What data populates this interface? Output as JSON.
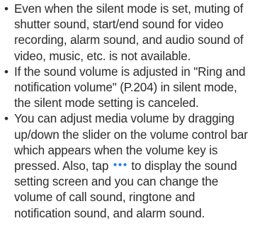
{
  "accent_color": "#2e7fd6",
  "icons": {
    "more_dots": "three-dots-icon"
  },
  "bullets": [
    {
      "lines": [
        "Even when the silent mode is set, muting of",
        "shutter sound, start/end sound for video",
        "recording, alarm sound, and audio sound of",
        "video, music, etc. is not available."
      ]
    },
    {
      "lines": [
        "If the sound volume is adjusted in \"Ring and",
        "notification volume\" (P.204) in silent mode,",
        "the silent mode setting is canceled."
      ]
    },
    {
      "lines": [
        "You can adjust media volume by dragging",
        "up/down the slider on the volume control bar",
        "which appears when the volume key is"
      ],
      "icon_line_before": "pressed. Also, tap",
      "icon_line_after": "to display the sound",
      "lines_after": [
        "setting screen and you can change the",
        "volume of call sound, ringtone and",
        "notification sound, and alarm sound."
      ]
    }
  ]
}
